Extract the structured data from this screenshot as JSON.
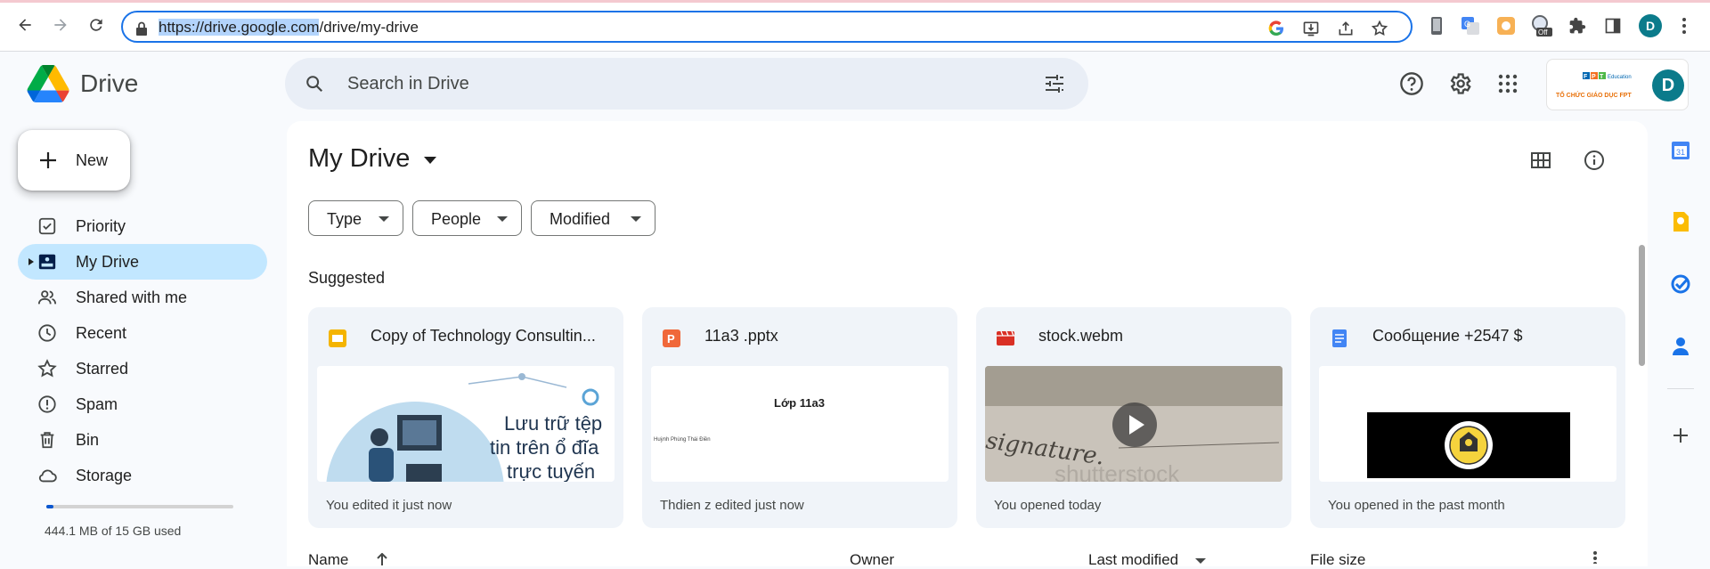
{
  "browser": {
    "url_selected": "https://drive.google.com",
    "url_rest": "/drive/my-drive",
    "profile_initial": "D",
    "ext_badge": "Off"
  },
  "app": {
    "name": "Drive",
    "search_placeholder": "Search in Drive",
    "account_initial": "D",
    "org_name": "TỔ CHỨC GIÁO DỤC FPT",
    "org_logo_text": "FPT Education"
  },
  "sidebar": {
    "new_label": "New",
    "items": [
      {
        "label": "Priority",
        "icon": "priority-icon"
      },
      {
        "label": "My Drive",
        "icon": "my-drive-icon",
        "active": true
      },
      {
        "label": "Shared with me",
        "icon": "shared-icon"
      },
      {
        "label": "Recent",
        "icon": "clock-icon"
      },
      {
        "label": "Starred",
        "icon": "star-icon"
      },
      {
        "label": "Spam",
        "icon": "spam-icon"
      },
      {
        "label": "Bin",
        "icon": "bin-icon"
      },
      {
        "label": "Storage",
        "icon": "cloud-icon"
      }
    ],
    "storage_text": "444.1 MB of 15 GB used",
    "storage_fraction": 0.03
  },
  "main": {
    "title": "My Drive",
    "filters": [
      "Type",
      "People",
      "Modified"
    ],
    "suggested_label": "Suggested",
    "cards": [
      {
        "name": "Copy of Technology Consultin...",
        "type": "slides",
        "color": "#f4b400",
        "meta": "You edited it just now",
        "thumb_lines": [
          "Lưu trữ tệp",
          "tin trên ổ đĩa",
          "trực tuyến"
        ]
      },
      {
        "name": "11a3 .pptx",
        "type": "powerpoint",
        "color": "#f0683a",
        "meta": "Thdien z edited just now",
        "thumb_title": "Lớp 11a3",
        "thumb_sub": "Huỳnh Phùng Thái Điền"
      },
      {
        "name": "stock.webm",
        "type": "video",
        "color": "#d93025",
        "meta": "You opened today",
        "thumb_word": "signature.",
        "thumb_wm": "shutterstock"
      },
      {
        "name": "Сообщение +2547 $",
        "type": "docs",
        "color": "#4285f4",
        "meta": "You opened in the past month"
      }
    ],
    "columns": [
      "Name",
      "Owner",
      "Last modified",
      "File size"
    ]
  }
}
